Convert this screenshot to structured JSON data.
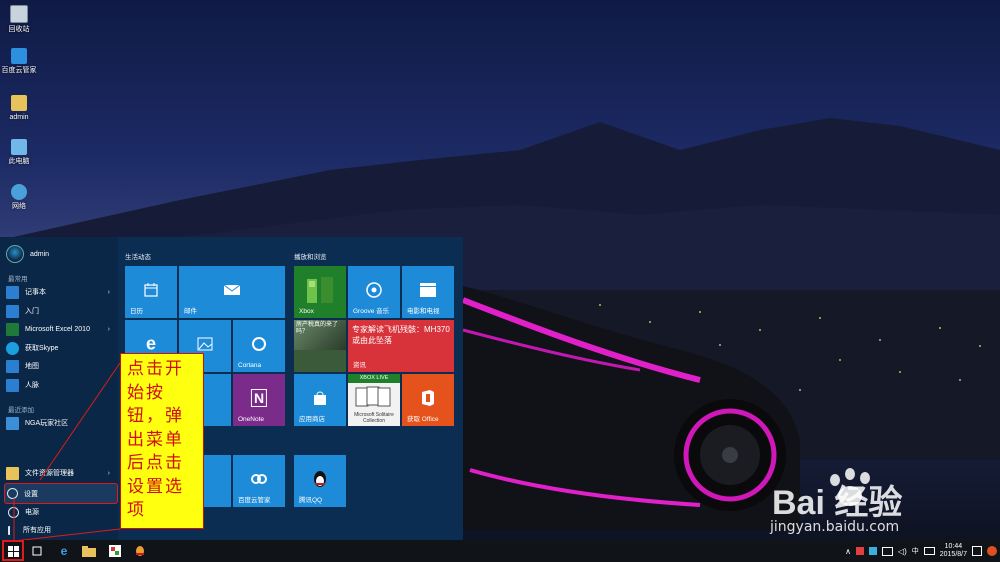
{
  "desktop": {
    "icons": [
      {
        "label": "回收站",
        "icon": "recycle-bin-icon"
      },
      {
        "label": "百度云管家",
        "icon": "baidu-cloud-icon"
      },
      {
        "label": "admin",
        "icon": "user-folder-icon"
      },
      {
        "label": "此电脑",
        "icon": "this-pc-icon"
      },
      {
        "label": "网络",
        "icon": "network-icon"
      }
    ]
  },
  "start_menu": {
    "user": "admin",
    "most_used_label": "最常用",
    "most_used": [
      {
        "label": "记事本",
        "icon": "notepad-icon",
        "has_arrow": true
      },
      {
        "label": "入门",
        "icon": "get-started-icon",
        "has_arrow": false
      },
      {
        "label": "Microsoft Excel 2010",
        "icon": "excel-icon",
        "has_arrow": true
      },
      {
        "label": "获取Skype",
        "icon": "skype-icon",
        "has_arrow": false
      },
      {
        "label": "地图",
        "icon": "maps-icon",
        "has_arrow": false
      },
      {
        "label": "人脉",
        "icon": "people-icon",
        "has_arrow": false
      }
    ],
    "recently_added_label": "最近添加",
    "recently_added": [
      {
        "label": "NGA玩家社区",
        "icon": "nga-icon"
      }
    ],
    "bottom": {
      "file_explorer": "文件资源管理器",
      "settings": "设置",
      "power": "电源",
      "all_apps": "所有应用"
    },
    "groups": {
      "life": "生活动态",
      "play": "播放和浏览"
    },
    "tiles": {
      "calendar": "日历",
      "mail": "邮件",
      "cortana": "Cortana",
      "onenote": "OneNote",
      "store": "应用商店",
      "baidu_cloud": "百度云管家",
      "tencent_qq": "腾讯QQ",
      "xbox": "Xbox",
      "groove": "Groove 音乐",
      "movies": "电影和电视",
      "photo_caption": "房产税真的来了吗？",
      "news_headline": "专家解读飞机残骸：MH370或由此坠落",
      "news_label": "资讯",
      "xbox_live": "XBOX LIVE",
      "solitaire": "Microsoft Solitaire Collection",
      "office": "获取 Office"
    }
  },
  "annotation": "点击开始按钮，弹出菜单后点击设置选项",
  "taskbar": {
    "ime": "中",
    "time": "10:44",
    "date": "2015/8/7"
  },
  "watermark": {
    "brand": "Bai 经验",
    "domain": "jingyan.baidu.com"
  },
  "colors": {
    "tile_blue": "#1e8bd8",
    "xbox_green": "#1f7f2a",
    "news_red": "#d8323a",
    "office_orange": "#e5521b",
    "onenote_purple": "#7b2c8a",
    "callout_yellow": "#ffff10",
    "highlight_red": "#e01a1a"
  }
}
